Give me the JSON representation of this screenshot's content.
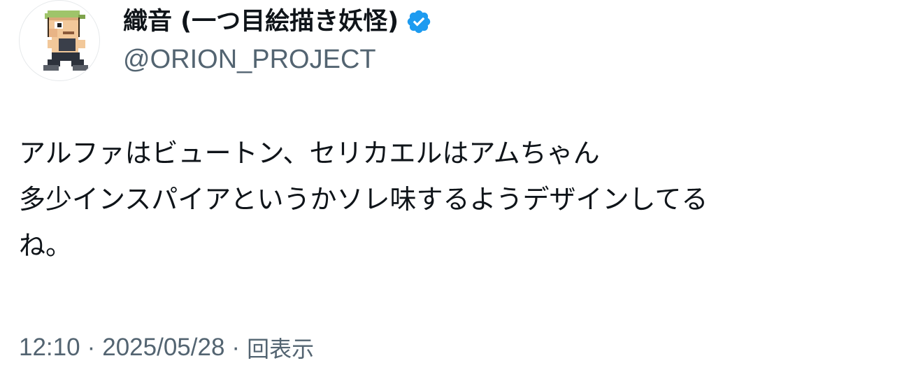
{
  "author": {
    "display_name": "織音 (一つ目絵描き妖怪)",
    "handle": "@ORION_PROJECT",
    "verified": true,
    "verified_color": "#1d9bf0"
  },
  "tweet": {
    "lines": [
      "アルファはビュートン、セリカエルはアムちゃん",
      "多少インスパイアというかソレ味するようデザインしてる",
      "ね。"
    ]
  },
  "meta": {
    "time": "12:10",
    "separator": "·",
    "date": "2025/05/28",
    "views_label": "回表示"
  },
  "icons": {
    "avatar": "pixel-character-avatar",
    "verified": "verified-badge-icon"
  }
}
